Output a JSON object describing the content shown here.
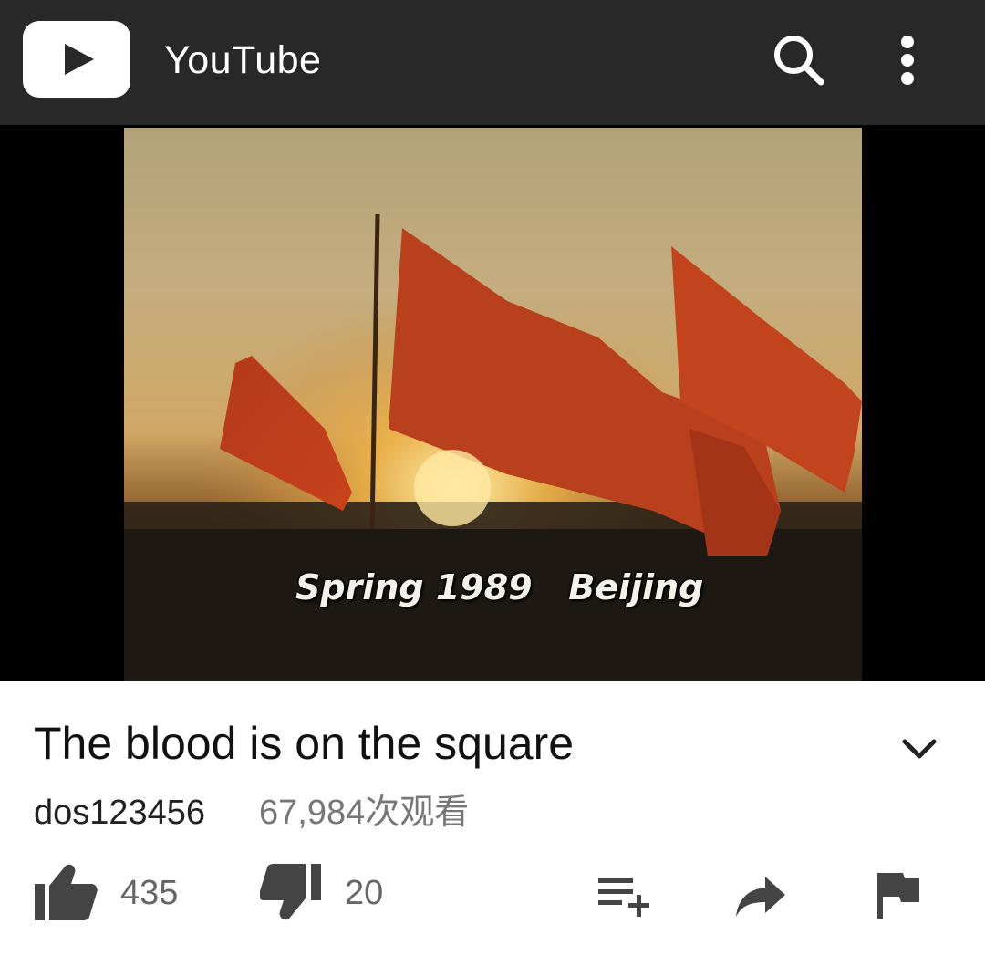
{
  "app_bar": {
    "title": "YouTube",
    "logo_icon": "youtube-play-icon",
    "search_icon": "search-icon",
    "menu_icon": "more-vert-icon",
    "background": "#282828"
  },
  "player": {
    "caption": "Spring 1989   Beijing"
  },
  "video": {
    "title": "The blood is on the square",
    "channel": "dos123456",
    "views": "67,984次观看",
    "expand_icon": "chevron-down-icon"
  },
  "actions": {
    "like_count": "435",
    "dislike_count": "20",
    "like_icon": "thumb-up-icon",
    "dislike_icon": "thumb-down-icon",
    "add_to_playlist_icon": "playlist-add-icon",
    "share_icon": "share-icon",
    "flag_icon": "flag-icon"
  }
}
